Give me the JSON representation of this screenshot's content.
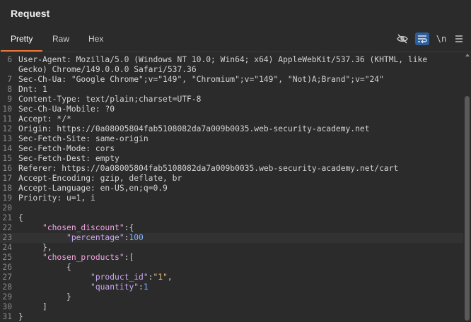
{
  "panel": {
    "title": "Request"
  },
  "tabs": [
    {
      "label": "Pretty",
      "active": true
    },
    {
      "label": "Raw",
      "active": false
    },
    {
      "label": "Hex",
      "active": false
    }
  ],
  "toolbar": {
    "hide_nonprinting_icon": "eye-slash-icon",
    "wrap_icon": "wrap-lines-icon",
    "newline_label": "\\n",
    "menu_icon": "hamburger-menu-icon"
  },
  "colors": {
    "accent_tab": "#e8763a",
    "active_tool": "#2e5f9a",
    "json_key": "#f0a5e0",
    "json_string": "#e6c07b",
    "json_number": "#7fb3ff"
  },
  "lines": [
    {
      "n": "6",
      "parts": [
        [
          "hn",
          "User-Agent: "
        ],
        [
          "hv",
          "Mozilla/5.0 (Windows NT 10.0; Win64; x64) AppleWebKit/537.36 (KHTML, like"
        ]
      ]
    },
    {
      "n": "",
      "parts": [
        [
          "hv",
          "Gecko) Chrome/149.0.0.0 Safari/537.36"
        ]
      ]
    },
    {
      "n": "7",
      "parts": [
        [
          "hn",
          "Sec-Ch-Ua: "
        ],
        [
          "hv",
          "\"Google Chrome\";v=\"149\", \"Chromium\";v=\"149\", \"Not)A;Brand\";v=\"24\""
        ]
      ]
    },
    {
      "n": "8",
      "parts": [
        [
          "hn",
          "Dnt: "
        ],
        [
          "hv",
          "1"
        ]
      ]
    },
    {
      "n": "9",
      "parts": [
        [
          "hn",
          "Content-Type: "
        ],
        [
          "hv",
          "text/plain;charset=UTF-8"
        ]
      ]
    },
    {
      "n": "10",
      "parts": [
        [
          "hn",
          "Sec-Ch-Ua-Mobile: "
        ],
        [
          "hv",
          "?0"
        ]
      ]
    },
    {
      "n": "11",
      "parts": [
        [
          "hn",
          "Accept: "
        ],
        [
          "hv",
          "*/*"
        ]
      ]
    },
    {
      "n": "12",
      "parts": [
        [
          "hn",
          "Origin: "
        ],
        [
          "hv",
          "https://0a08005804fab5108082da7a009b0035.web-security-academy.net"
        ]
      ]
    },
    {
      "n": "13",
      "parts": [
        [
          "hn",
          "Sec-Fetch-Site: "
        ],
        [
          "hv",
          "same-origin"
        ]
      ]
    },
    {
      "n": "14",
      "parts": [
        [
          "hn",
          "Sec-Fetch-Mode: "
        ],
        [
          "hv",
          "cors"
        ]
      ]
    },
    {
      "n": "15",
      "parts": [
        [
          "hn",
          "Sec-Fetch-Dest: "
        ],
        [
          "hv",
          "empty"
        ]
      ]
    },
    {
      "n": "16",
      "parts": [
        [
          "hn",
          "Referer: "
        ],
        [
          "hv",
          "https://0a08005804fab5108082da7a009b0035.web-security-academy.net/cart"
        ]
      ]
    },
    {
      "n": "17",
      "parts": [
        [
          "hn",
          "Accept-Encoding: "
        ],
        [
          "hv",
          "gzip, deflate, br"
        ]
      ]
    },
    {
      "n": "18",
      "parts": [
        [
          "hn",
          "Accept-Language: "
        ],
        [
          "hv",
          "en-US,en;q=0.9"
        ]
      ]
    },
    {
      "n": "19",
      "parts": [
        [
          "hn",
          "Priority: "
        ],
        [
          "hv",
          "u=1, i"
        ]
      ]
    },
    {
      "n": "20",
      "parts": []
    },
    {
      "n": "21",
      "parts": [
        [
          "hv",
          "{"
        ]
      ]
    },
    {
      "n": "22",
      "parts": [
        [
          "hv",
          "     "
        ],
        [
          "jk",
          "\"chosen_discount\""
        ],
        [
          "hv",
          ":{"
        ]
      ]
    },
    {
      "n": "23",
      "current": true,
      "parts": [
        [
          "hv",
          "          "
        ],
        [
          "jk2",
          "\"percentage\""
        ],
        [
          "hv",
          ":"
        ],
        [
          "jn",
          "100"
        ]
      ]
    },
    {
      "n": "24",
      "parts": [
        [
          "hv",
          "     },"
        ]
      ]
    },
    {
      "n": "25",
      "parts": [
        [
          "hv",
          "     "
        ],
        [
          "jk",
          "\"chosen_products\""
        ],
        [
          "hv",
          ":["
        ]
      ]
    },
    {
      "n": "26",
      "parts": [
        [
          "hv",
          "          {"
        ]
      ]
    },
    {
      "n": "27",
      "parts": [
        [
          "hv",
          "               "
        ],
        [
          "jk2",
          "\"product_id\""
        ],
        [
          "hv",
          ":"
        ],
        [
          "js",
          "\"1\""
        ],
        [
          "hv",
          ","
        ]
      ]
    },
    {
      "n": "28",
      "parts": [
        [
          "hv",
          "               "
        ],
        [
          "jk2",
          "\"quantity\""
        ],
        [
          "hv",
          ":"
        ],
        [
          "jn",
          "1"
        ]
      ]
    },
    {
      "n": "29",
      "parts": [
        [
          "hv",
          "          }"
        ]
      ]
    },
    {
      "n": "30",
      "parts": [
        [
          "hv",
          "     ]"
        ]
      ]
    },
    {
      "n": "31",
      "parts": [
        [
          "hv",
          "}"
        ]
      ]
    }
  ]
}
